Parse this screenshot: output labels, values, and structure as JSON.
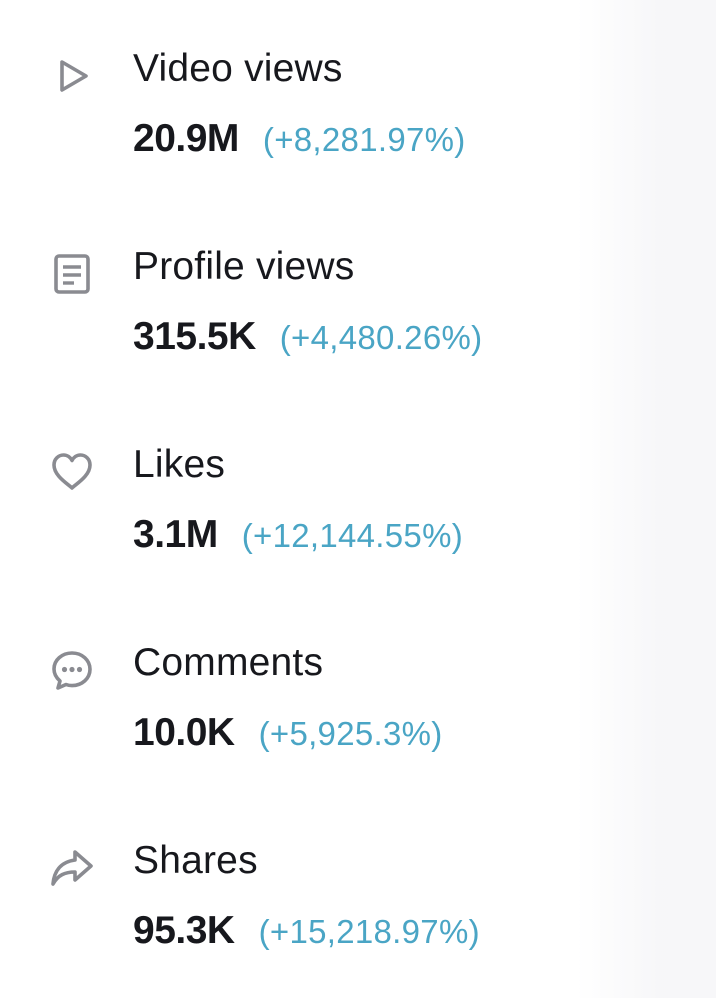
{
  "metrics": [
    {
      "icon": "play-icon",
      "label": "Video views",
      "value": "20.9M",
      "change": "(+8,281.97%)"
    },
    {
      "icon": "profile-icon",
      "label": "Profile views",
      "value": "315.5K",
      "change": "(+4,480.26%)"
    },
    {
      "icon": "heart-icon",
      "label": "Likes",
      "value": "3.1M",
      "change": "(+12,144.55%)"
    },
    {
      "icon": "comment-icon",
      "label": "Comments",
      "value": "10.0K",
      "change": "(+5,925.3%)"
    },
    {
      "icon": "share-icon",
      "label": "Shares",
      "value": "95.3K",
      "change": "(+15,218.97%)"
    }
  ],
  "colors": {
    "text": "#17181d",
    "change": "#4aa5c5",
    "icon": "#8a8b91"
  }
}
